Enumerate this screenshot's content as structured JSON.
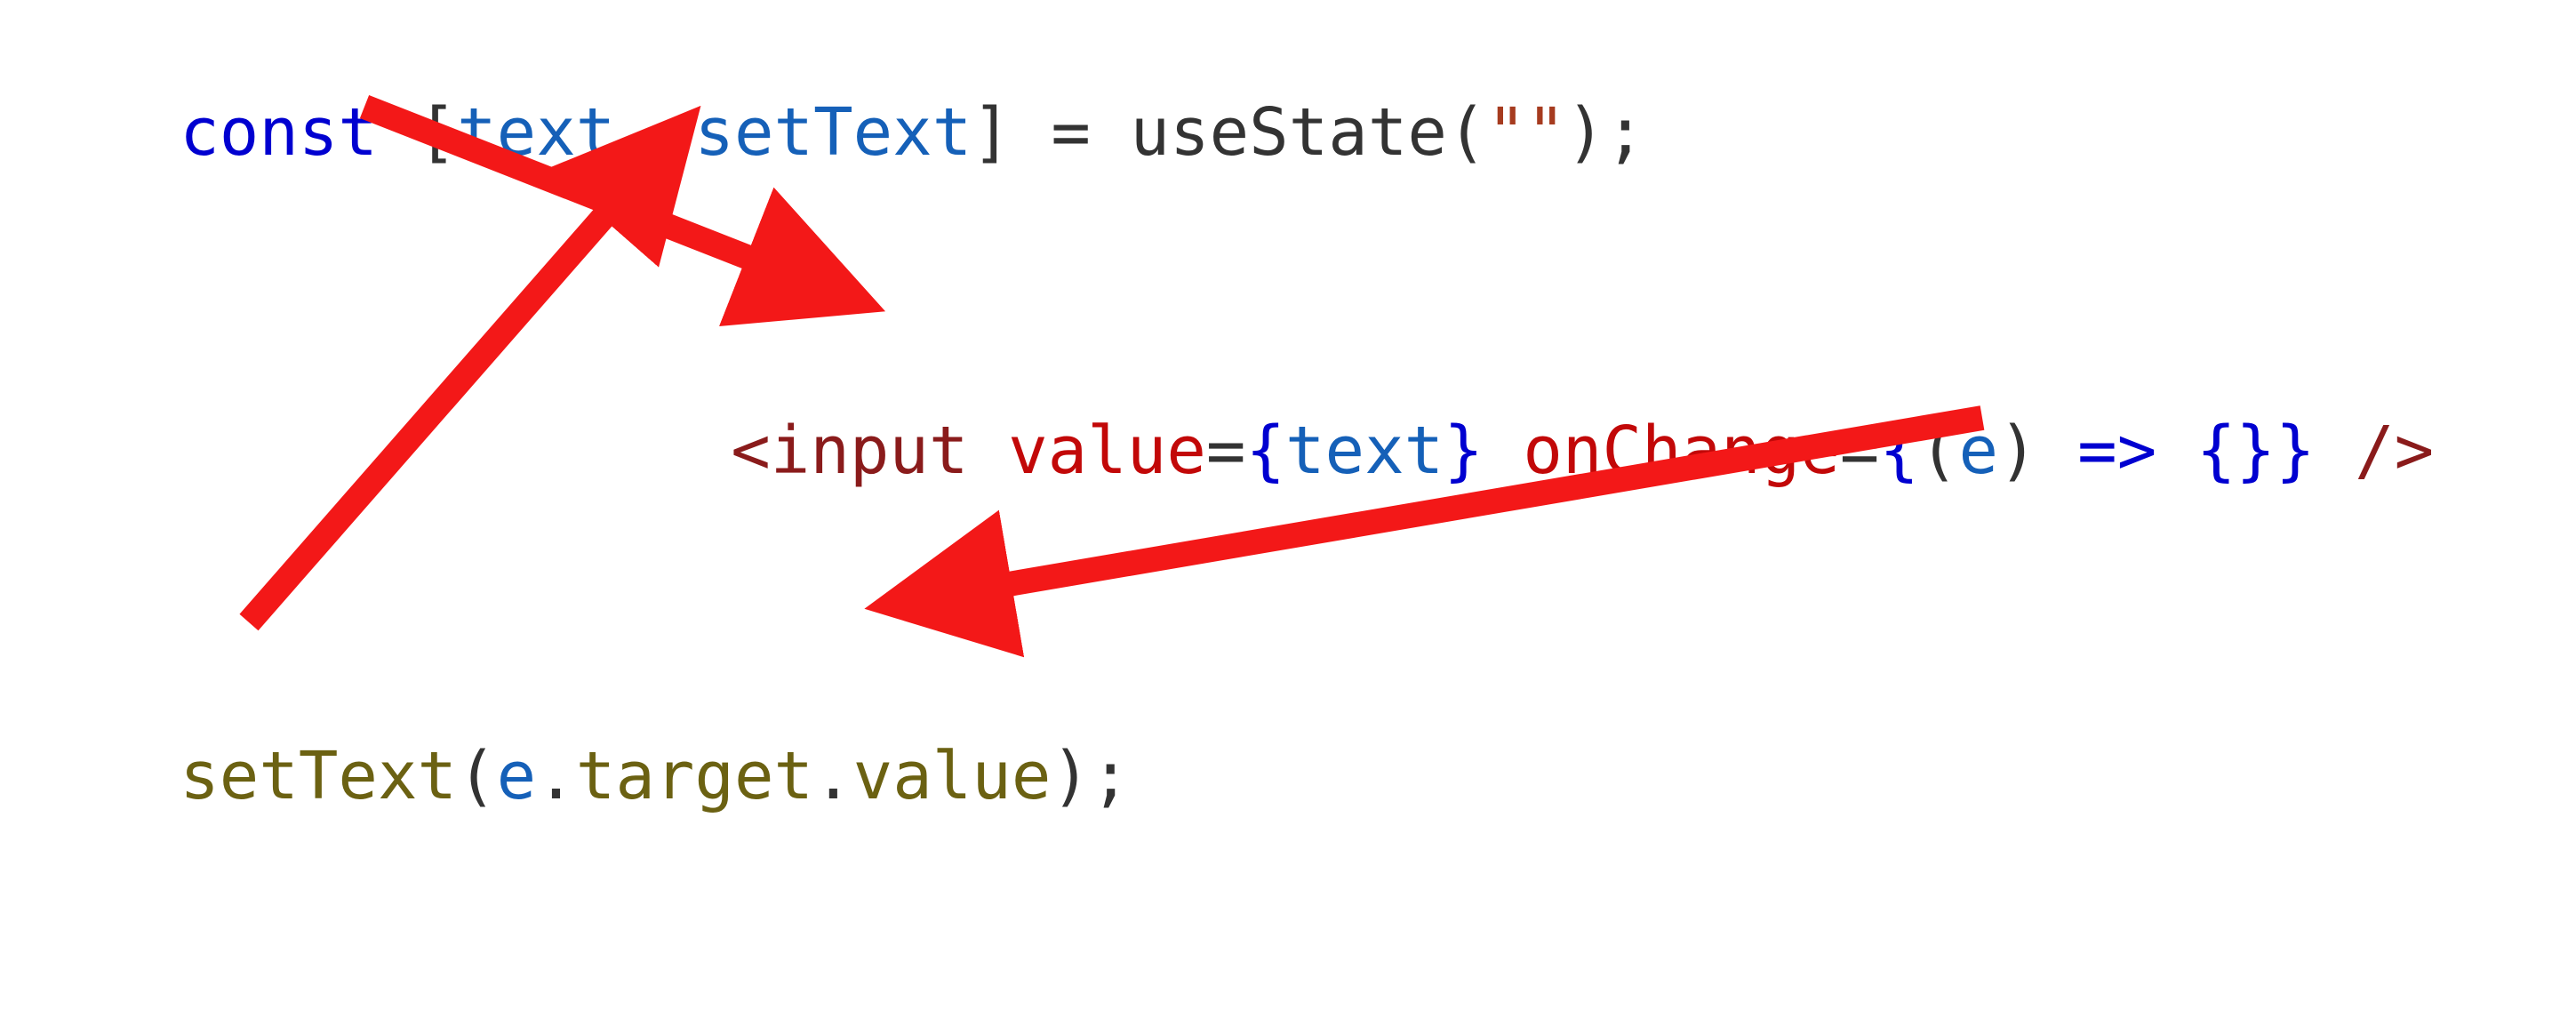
{
  "line1": {
    "kw_const": "const",
    "open_br": " [",
    "var_text": "text",
    "comma": ", ",
    "var_setText": "setText",
    "close_br": "] ",
    "eq": "= ",
    "useState": "useState",
    "paren_open": "(",
    "str_empty": "\"\"",
    "paren_close_semi": ");"
  },
  "line2": {
    "lt": "<",
    "tag": "input",
    "sp1": " ",
    "attr_value": "value",
    "eq1": "=",
    "brace_o1": "{",
    "text_ref": "text",
    "brace_c1": "}",
    "sp2": " ",
    "attr_onChange": "onChange",
    "eq2": "=",
    "brace_o2": "{",
    "paren_o": "(",
    "param_e": "e",
    "paren_c": ")",
    "sp3": " ",
    "arrow": "=>",
    "sp4": " ",
    "body_open": "{",
    "body_close": "}",
    "brace_c2": "}",
    "sp5": " ",
    "selfclose": "/>"
  },
  "line3": {
    "fn": "setText",
    "paren_o": "(",
    "e": "e",
    "dot1": ".",
    "target": "target",
    "dot2": ".",
    "value": "value",
    "paren_c_semi": ");"
  },
  "arrows": {
    "color": "#f31818",
    "stroke_width": 28
  }
}
